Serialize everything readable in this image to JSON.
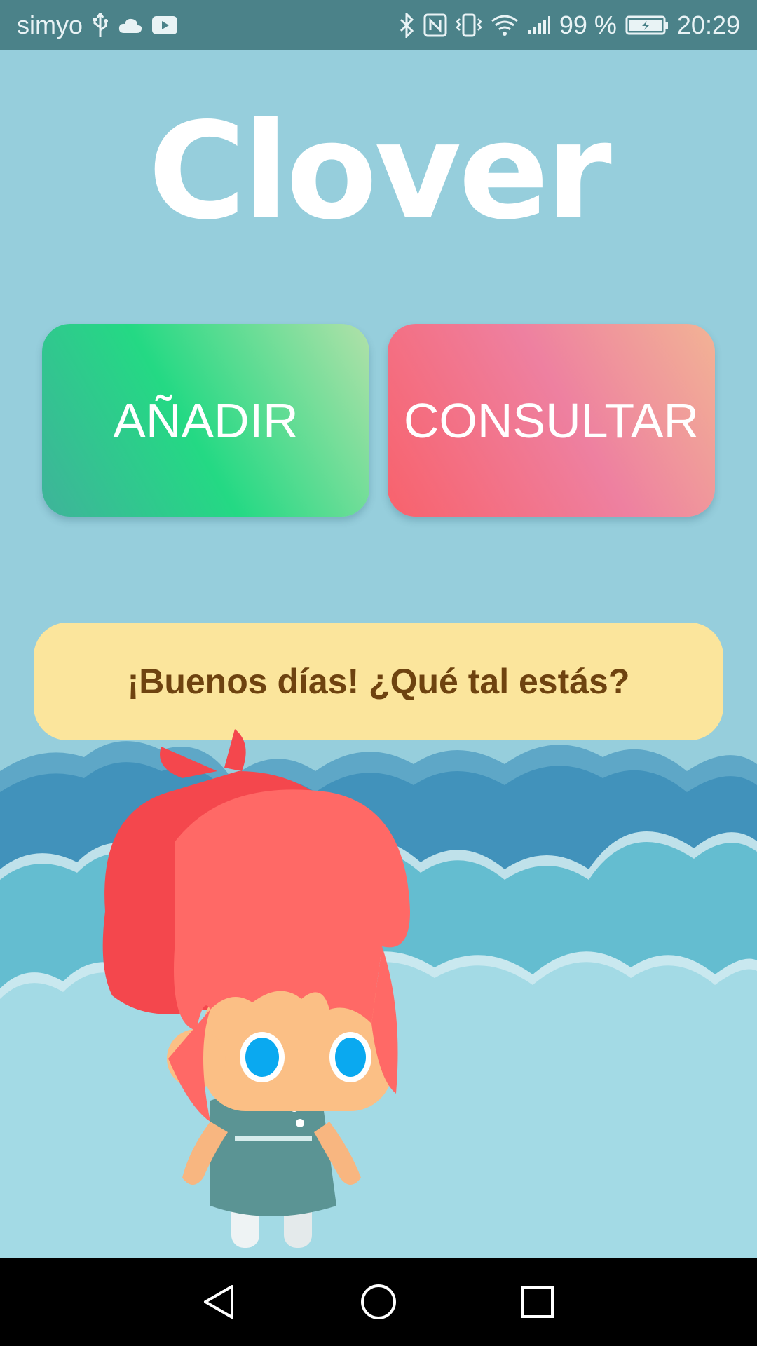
{
  "status_bar": {
    "carrier": "simyo",
    "battery": "99 %",
    "time": "20:29",
    "icons": [
      "usb-icon",
      "cloud-icon",
      "youtube-icon",
      "bluetooth-icon",
      "nfc-icon",
      "vibrate-icon",
      "wifi-icon",
      "signal-icon",
      "battery-icon"
    ]
  },
  "app": {
    "title": "Clover"
  },
  "actions": {
    "add_label": "AÑADIR",
    "consult_label": "CONSULTAR"
  },
  "greeting": {
    "text": "¡Buenos días! ¿Qué tal estás?"
  },
  "colors": {
    "background": "#96cedc",
    "status_bar": "#4b8289",
    "add_gradient": [
      "#3fb39a",
      "#24d984",
      "#b1e1a9"
    ],
    "consult_gradient": [
      "#f8626c",
      "#ee80a0",
      "#f2b395"
    ],
    "greeting_bg": "#fbe59c",
    "greeting_text": "#6e4310"
  },
  "nav_bar": {
    "icons": [
      "back-icon",
      "home-icon",
      "recents-icon"
    ]
  }
}
